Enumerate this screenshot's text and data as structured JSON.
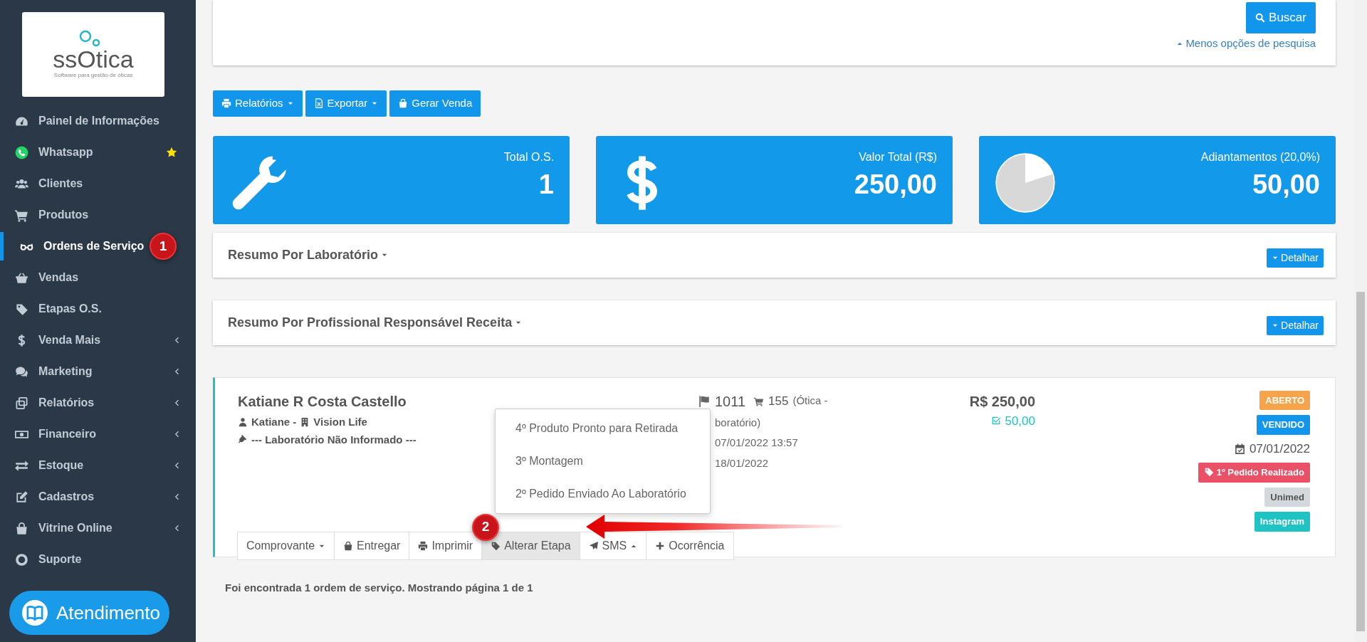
{
  "sidebar": {
    "logo": {
      "name": "ssOtica",
      "tagline": "Software para gestão de óticas"
    },
    "items": [
      {
        "label": "Painel de Informações",
        "selected": false,
        "submenu": false,
        "starred": false
      },
      {
        "label": "Whatsapp",
        "selected": false,
        "submenu": false,
        "starred": true
      },
      {
        "label": "Clientes",
        "selected": false,
        "submenu": false,
        "starred": false
      },
      {
        "label": "Produtos",
        "selected": false,
        "submenu": false,
        "starred": false
      },
      {
        "label": "Ordens de Serviço",
        "selected": true,
        "submenu": false,
        "starred": false
      },
      {
        "label": "Vendas",
        "selected": false,
        "submenu": false,
        "starred": false
      },
      {
        "label": "Etapas O.S.",
        "selected": false,
        "submenu": false,
        "starred": false
      },
      {
        "label": "Venda Mais",
        "selected": false,
        "submenu": true,
        "starred": false
      },
      {
        "label": "Marketing",
        "selected": false,
        "submenu": true,
        "starred": false
      },
      {
        "label": "Relatórios",
        "selected": false,
        "submenu": true,
        "starred": false
      },
      {
        "label": "Financeiro",
        "selected": false,
        "submenu": true,
        "starred": false
      },
      {
        "label": "Estoque",
        "selected": false,
        "submenu": true,
        "starred": false
      },
      {
        "label": "Cadastros",
        "selected": false,
        "submenu": true,
        "starred": false
      },
      {
        "label": "Vitrine Online",
        "selected": false,
        "submenu": true,
        "starred": false
      },
      {
        "label": "Suporte",
        "selected": false,
        "submenu": false,
        "starred": false
      }
    ],
    "step_marker": "1"
  },
  "support_button": "Atendimento",
  "search_panel": {
    "search_button": "Buscar",
    "toggle_link": "Menos opções de pesquisa"
  },
  "toolbar": [
    {
      "label": "Relatórios",
      "kind": "dropdown"
    },
    {
      "label": "Exportar",
      "kind": "dropdown"
    },
    {
      "label": "Gerar Venda",
      "kind": "button"
    }
  ],
  "stats": [
    {
      "label": "Total O.S.",
      "value": "1"
    },
    {
      "label": "Valor Total (R$)",
      "value": "250,00"
    },
    {
      "label": "Adiantamentos (20,0%)",
      "value": "50,00"
    }
  ],
  "summaries": [
    {
      "title": "Resumo Por Laboratório",
      "button": "Detalhar"
    },
    {
      "title": "Resumo Por Profissional Responsável Receita",
      "button": "Detalhar"
    }
  ],
  "order": {
    "customer": "Katiane R Costa Castello",
    "seller": "Katiane -",
    "store": "Vision Life",
    "lab": "--- Laboratório Não Informado ---",
    "os_number": "1011",
    "sale_number": "155",
    "sale_note": "(Ótica -",
    "details": [
      "boratório)",
      "07/01/2022 13:57",
      "18/01/2022"
    ],
    "total": "R$ 250,00",
    "paid": "50,00",
    "tags": [
      {
        "kind": "badge",
        "text": "ABERTO",
        "color": "#f6a44b"
      },
      {
        "kind": "badge",
        "text": "VENDIDO",
        "color": "#1296ec"
      },
      {
        "kind": "date",
        "text": "07/01/2022"
      },
      {
        "kind": "stage",
        "text": "1º Pedido Realizado",
        "color": "#ea5167"
      },
      {
        "kind": "badge",
        "text": "Unimed",
        "color": "#d3d8dc"
      },
      {
        "kind": "badge",
        "text": "Instagram",
        "color": "#1fc3c3"
      }
    ],
    "actions": [
      {
        "label": "Comprovante",
        "kind": "dropdown",
        "selected": false
      },
      {
        "label": "Entregar",
        "kind": "button",
        "selected": false
      },
      {
        "label": "Imprimir",
        "kind": "button",
        "selected": false
      },
      {
        "label": "Alterar Etapa",
        "kind": "button",
        "selected": true
      },
      {
        "label": "SMS",
        "kind": "dropup",
        "selected": false
      },
      {
        "label": "Ocorrência",
        "kind": "button",
        "selected": false
      }
    ],
    "stage_menu": [
      "4º Produto Pronto para Retirada",
      "3º Montagem",
      "2º Pedido Enviado Ao Laboratório"
    ],
    "step_marker": "2"
  },
  "footer": "Foi encontrada 1 ordem de serviço. Mostrando página 1 de 1"
}
